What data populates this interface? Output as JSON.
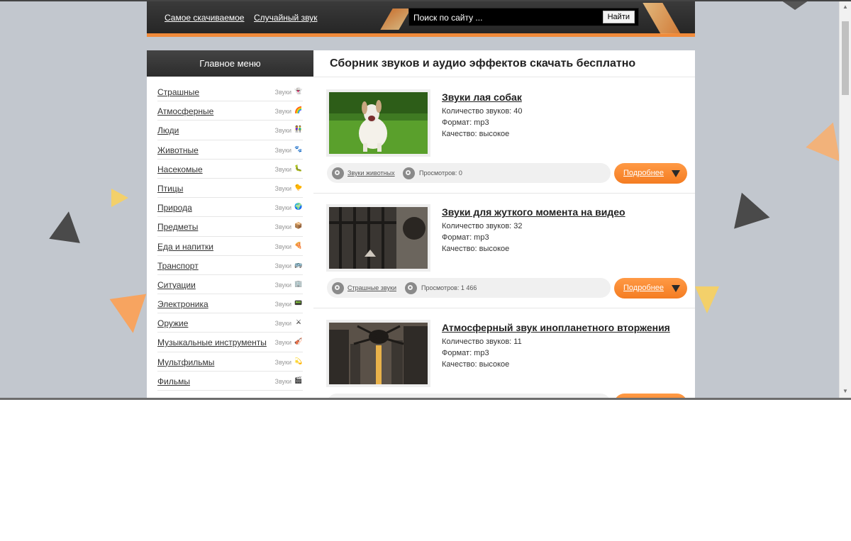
{
  "header": {
    "nav": [
      "Самое скачиваемое",
      "Случайный звук"
    ],
    "search_placeholder": "Поиск по сайту ...",
    "search_button": "Найти",
    "accent_color": "#f08a3a"
  },
  "sidebar": {
    "title": "Главное меню",
    "tag_label": "Звуки",
    "items": [
      {
        "label": "Страшные",
        "icon": "ghost-icon",
        "emoji": "👻"
      },
      {
        "label": "Атмосферные",
        "icon": "rainbow-icon",
        "emoji": "🌈"
      },
      {
        "label": "Люди",
        "icon": "people-icon",
        "emoji": "👫"
      },
      {
        "label": "Животные",
        "icon": "paw-icon",
        "emoji": "🐾"
      },
      {
        "label": "Насекомые",
        "icon": "bug-icon",
        "emoji": "🐛"
      },
      {
        "label": "Птицы",
        "icon": "bird-icon",
        "emoji": "🐤"
      },
      {
        "label": "Природа",
        "icon": "globe-icon",
        "emoji": "🌍"
      },
      {
        "label": "Предметы",
        "icon": "box-icon",
        "emoji": "📦"
      },
      {
        "label": "Еда и напитки",
        "icon": "pizza-icon",
        "emoji": "🍕"
      },
      {
        "label": "Транспорт",
        "icon": "bus-icon",
        "emoji": "🚌"
      },
      {
        "label": "Ситуации",
        "icon": "building-icon",
        "emoji": "🏢"
      },
      {
        "label": "Электроника",
        "icon": "device-icon",
        "emoji": "📟"
      },
      {
        "label": "Оружие",
        "icon": "weapon-icon",
        "emoji": "⚔"
      },
      {
        "label": "Музыкальные инструменты",
        "icon": "violin-icon",
        "emoji": "🎻"
      },
      {
        "label": "Мультфильмы",
        "icon": "sparkle-icon",
        "emoji": "💫"
      },
      {
        "label": "Фильмы",
        "icon": "clapper-icon",
        "emoji": "🎬"
      }
    ]
  },
  "main": {
    "title": "Сборник звуков и аудио эффектов скачать бесплатно",
    "more_label": "Подробнее",
    "cards": [
      {
        "title": "Звуки лая собак",
        "count": "Количество звуков: 40",
        "format": "Формат: mp3",
        "quality": "Качество: высокое",
        "category": "Звуки животных",
        "views": "Просмотров: 0",
        "thumb": "barking-dog-photo"
      },
      {
        "title": "Звуки для жуткого момента на видео",
        "count": "Количество звуков: 32",
        "format": "Формат: mp3",
        "quality": "Качество: высокое",
        "category": "Страшные звуки",
        "views": "Просмотров: 1 466",
        "thumb": "dark-cell-bars-photo"
      },
      {
        "title": "Атмосферный звук инопланетного вторжения",
        "count": "Количество звуков: 11",
        "format": "Формат: mp3",
        "quality": "Качество: высокое",
        "category": "",
        "views": "",
        "thumb": "alien-invasion-city-photo"
      }
    ]
  }
}
